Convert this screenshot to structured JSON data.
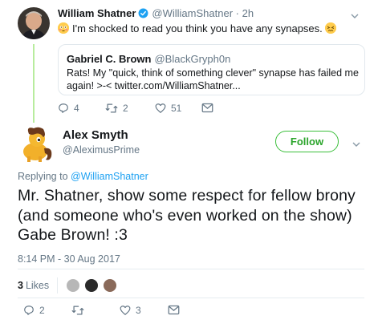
{
  "parent_tweet": {
    "author_name": "William Shatner",
    "author_handle": "@WilliamShatner",
    "time": "· 2h",
    "text": "I'm shocked to read you think you have any synapses.",
    "emoji_start": "flushed-face",
    "emoji_end": "confounded-face",
    "quoted": {
      "author_name": "Gabriel C. Brown",
      "author_handle": "@BlackGryph0n",
      "text": "Rats! My \"quick, think of something clever\" synapse has failed me again! >-< twitter.com/WilliamShatner..."
    },
    "actions": {
      "replies": "4",
      "retweets": "2",
      "likes": "51"
    }
  },
  "main_tweet": {
    "author_name": "Alex Smyth",
    "author_handle": "@AleximusPrime",
    "follow_label": "Follow",
    "replying_prefix": "Replying to",
    "replying_to": "@WilliamShatner",
    "text": "Mr. Shatner, show some respect for fellow brony (and someone who's even worked on the show) Gabe Brown!    :3",
    "timestamp": "8:14 PM - 30 Aug 2017",
    "likes_count": "3",
    "likes_label": "Likes",
    "actions": {
      "replies": "2",
      "retweets": "",
      "likes": "3"
    }
  },
  "colors": {
    "accent_blue": "#1da1f2",
    "follow_green": "#2aa42a",
    "thread_line": "#b8ec9e",
    "muted": "#657786"
  }
}
